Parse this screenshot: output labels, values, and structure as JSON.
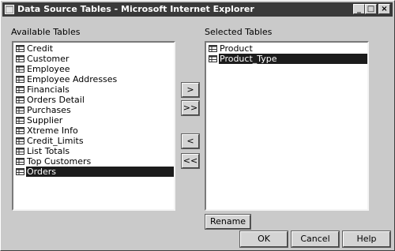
{
  "window": {
    "title": "Data Source Tables - Microsoft Internet Explorer"
  },
  "caption_buttons": {
    "minimize": "_",
    "maximize": "□",
    "close": "×"
  },
  "available": {
    "label": "Available Tables",
    "items": [
      {
        "label": "Credit"
      },
      {
        "label": "Customer"
      },
      {
        "label": "Employee"
      },
      {
        "label": "Employee Addresses"
      },
      {
        "label": "Financials"
      },
      {
        "label": "Orders Detail"
      },
      {
        "label": "Purchases"
      },
      {
        "label": "Supplier"
      },
      {
        "label": "Xtreme Info"
      },
      {
        "label": "Credit_Limits"
      },
      {
        "label": "List Totals"
      },
      {
        "label": "Top Customers"
      },
      {
        "label": "Orders"
      }
    ],
    "selected_index": 12
  },
  "selected": {
    "label": "Selected Tables",
    "items": [
      {
        "label": "Product"
      },
      {
        "label": "Product_Type"
      }
    ],
    "selected_index": 1
  },
  "transfer_buttons": {
    "add": ">",
    "add_all": ">>",
    "remove": "<",
    "remove_all": "<<"
  },
  "buttons": {
    "rename": "Rename",
    "ok": "OK",
    "cancel": "Cancel",
    "help": "Help"
  },
  "colors": {
    "titlebar": "#3a3a3a",
    "selection": "#1c1c1c",
    "face": "#cacaca"
  }
}
